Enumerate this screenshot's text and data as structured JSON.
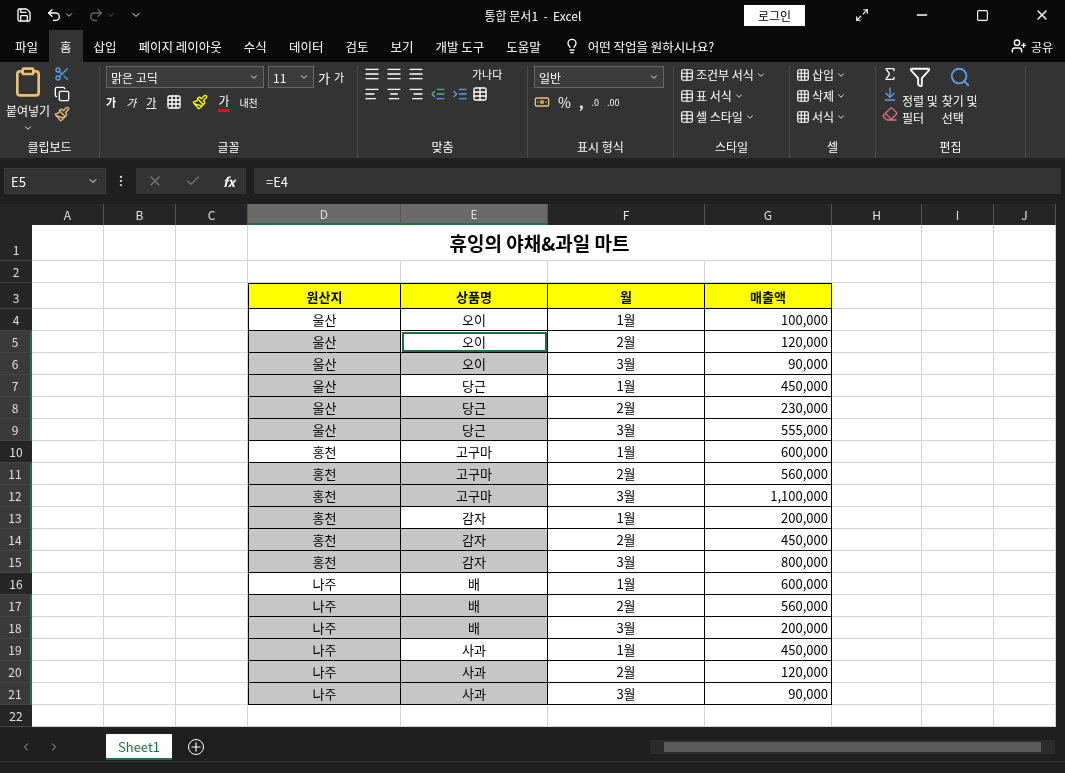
{
  "title_bar": {
    "title": "통합 문서1  -  Excel",
    "login": "로그인"
  },
  "menu_tabs": [
    {
      "label": "파일",
      "selected": false
    },
    {
      "label": "홈",
      "selected": true
    },
    {
      "label": "삽입",
      "selected": false
    },
    {
      "label": "페이지 레이아웃",
      "selected": false
    },
    {
      "label": "수식",
      "selected": false
    },
    {
      "label": "데이터",
      "selected": false
    },
    {
      "label": "검토",
      "selected": false
    },
    {
      "label": "보기",
      "selected": false
    },
    {
      "label": "개발 도구",
      "selected": false
    },
    {
      "label": "도움말",
      "selected": false
    }
  ],
  "tell_me": "어떤 작업을 원하시나요?",
  "share": "공유",
  "ribbon": {
    "clipboard": {
      "paste": "붙여넣기",
      "label": "클립보드"
    },
    "font": {
      "font_name": "맑은 고딕",
      "font_size": "11",
      "grow": "가",
      "shrink": "가",
      "bold": "가",
      "italic": "가",
      "underline": "가",
      "phonetic": "내천",
      "font_color": "가",
      "label": "글꼴"
    },
    "alignment": {
      "wrap": "가나다",
      "label": "맞춤"
    },
    "number": {
      "format": "일반",
      "percent": "%",
      "comma": ",",
      "increase_decimal": ".0",
      "decrease_decimal": ".00",
      "label": "표시 형식"
    },
    "styles": {
      "items": [
        "조건부 서식",
        "표 서식",
        "셀 스타일"
      ],
      "label": "스타일"
    },
    "cells": {
      "items": [
        "삽입",
        "삭제",
        "서식"
      ],
      "label": "셀"
    },
    "editing": {
      "sort": [
        "정렬 및",
        "필터"
      ],
      "find": [
        "찾기 및",
        "선택"
      ],
      "label": "편집"
    }
  },
  "formula_bar": {
    "name_box": "E5",
    "fx": "fx",
    "formula": "=E4"
  },
  "sheet": {
    "columns": [
      {
        "label": "A",
        "selected": false
      },
      {
        "label": "B",
        "selected": false
      },
      {
        "label": "C",
        "selected": false
      },
      {
        "label": "D",
        "selected": true
      },
      {
        "label": "E",
        "selected": true
      },
      {
        "label": "F",
        "selected": false
      },
      {
        "label": "G",
        "selected": false
      },
      {
        "label": "H",
        "selected": false
      },
      {
        "label": "I",
        "selected": false
      },
      {
        "label": "J",
        "selected": false
      }
    ],
    "row_numbers": [
      "1",
      "2",
      "3",
      "4",
      "5",
      "6",
      "7",
      "8",
      "9",
      "10",
      "11",
      "12",
      "13",
      "14",
      "15",
      "16",
      "17",
      "18",
      "19",
      "20",
      "21",
      "22"
    ],
    "title": "휴잉의 야채&과일 마트",
    "headers": [
      "원산지",
      "상품명",
      "월",
      "매출액"
    ],
    "rows": [
      {
        "origin": "울산",
        "product": "오이",
        "month": "1월",
        "amount": "100,000",
        "origin_selected": false,
        "product_selected": false,
        "active": false
      },
      {
        "origin": "울산",
        "product": "오이",
        "month": "2월",
        "amount": "120,000",
        "origin_selected": true,
        "product_selected": false,
        "active": true
      },
      {
        "origin": "울산",
        "product": "오이",
        "month": "3월",
        "amount": "90,000",
        "origin_selected": true,
        "product_selected": true,
        "active": false
      },
      {
        "origin": "울산",
        "product": "당근",
        "month": "1월",
        "amount": "450,000",
        "origin_selected": true,
        "product_selected": false,
        "active": false
      },
      {
        "origin": "울산",
        "product": "당근",
        "month": "2월",
        "amount": "230,000",
        "origin_selected": true,
        "product_selected": true,
        "active": false
      },
      {
        "origin": "울산",
        "product": "당근",
        "month": "3월",
        "amount": "555,000",
        "origin_selected": true,
        "product_selected": true,
        "active": false
      },
      {
        "origin": "홍천",
        "product": "고구마",
        "month": "1월",
        "amount": "600,000",
        "origin_selected": false,
        "product_selected": false,
        "active": false
      },
      {
        "origin": "홍천",
        "product": "고구마",
        "month": "2월",
        "amount": "560,000",
        "origin_selected": true,
        "product_selected": true,
        "active": false
      },
      {
        "origin": "홍천",
        "product": "고구마",
        "month": "3월",
        "amount": "1,100,000",
        "origin_selected": true,
        "product_selected": true,
        "active": false
      },
      {
        "origin": "홍천",
        "product": "감자",
        "month": "1월",
        "amount": "200,000",
        "origin_selected": true,
        "product_selected": false,
        "active": false
      },
      {
        "origin": "홍천",
        "product": "감자",
        "month": "2월",
        "amount": "450,000",
        "origin_selected": true,
        "product_selected": true,
        "active": false
      },
      {
        "origin": "홍천",
        "product": "감자",
        "month": "3월",
        "amount": "800,000",
        "origin_selected": true,
        "product_selected": true,
        "active": false
      },
      {
        "origin": "나주",
        "product": "배",
        "month": "1월",
        "amount": "600,000",
        "origin_selected": false,
        "product_selected": false,
        "active": false
      },
      {
        "origin": "나주",
        "product": "배",
        "month": "2월",
        "amount": "560,000",
        "origin_selected": true,
        "product_selected": true,
        "active": false
      },
      {
        "origin": "나주",
        "product": "배",
        "month": "3월",
        "amount": "200,000",
        "origin_selected": true,
        "product_selected": true,
        "active": false
      },
      {
        "origin": "나주",
        "product": "사과",
        "month": "1월",
        "amount": "450,000",
        "origin_selected": true,
        "product_selected": false,
        "active": false
      },
      {
        "origin": "나주",
        "product": "사과",
        "month": "2월",
        "amount": "120,000",
        "origin_selected": true,
        "product_selected": true,
        "active": false
      },
      {
        "origin": "나주",
        "product": "사과",
        "month": "3월",
        "amount": "90,000",
        "origin_selected": true,
        "product_selected": true,
        "active": false
      }
    ]
  },
  "sheet_tabs": [
    {
      "label": "Sheet1",
      "selected": true
    }
  ]
}
